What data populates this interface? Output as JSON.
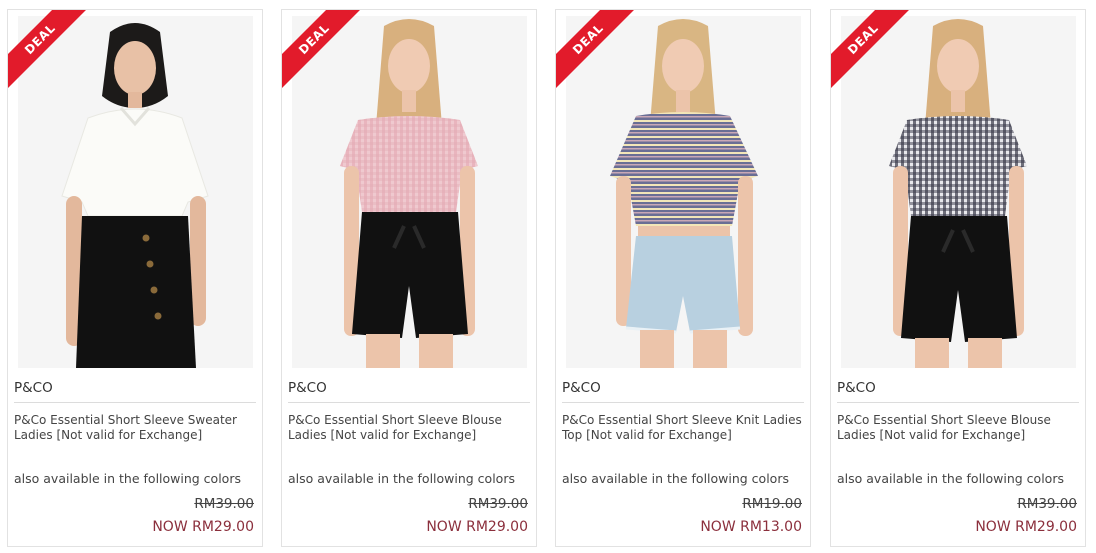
{
  "badge_label": "DEAL",
  "colors": {
    "badge": "#e21b2b",
    "now_price": "#8b2f3c"
  },
  "products": [
    {
      "brand": "P&CO",
      "name": "P&Co Essential Short Sleeve Sweater Ladies [Not valid for Exchange]",
      "colors_note": "also available in the following colors",
      "old_price": "RM39.00",
      "now_price": "NOW RM29.00",
      "image": "model-white-sweater-black-skirt"
    },
    {
      "brand": "P&CO",
      "name": "P&Co Essential Short Sleeve Blouse Ladies [Not valid for Exchange]",
      "colors_note": "also available in the following colors",
      "old_price": "RM39.00",
      "now_price": "NOW RM29.00",
      "image": "model-pink-gingham-blouse-black-shorts"
    },
    {
      "brand": "P&CO",
      "name": "P&Co Essential Short Sleeve Knit Ladies Top [Not valid for Exchange]",
      "colors_note": "also available in the following colors",
      "old_price": "RM19.00",
      "now_price": "NOW RM13.00",
      "image": "model-striped-knit-top-denim-shorts"
    },
    {
      "brand": "P&CO",
      "name": "P&Co Essential Short Sleeve Blouse Ladies [Not valid for Exchange]",
      "colors_note": "also available in the following colors",
      "old_price": "RM39.00",
      "now_price": "NOW RM29.00",
      "image": "model-black-gingham-blouse-black-shorts"
    }
  ]
}
